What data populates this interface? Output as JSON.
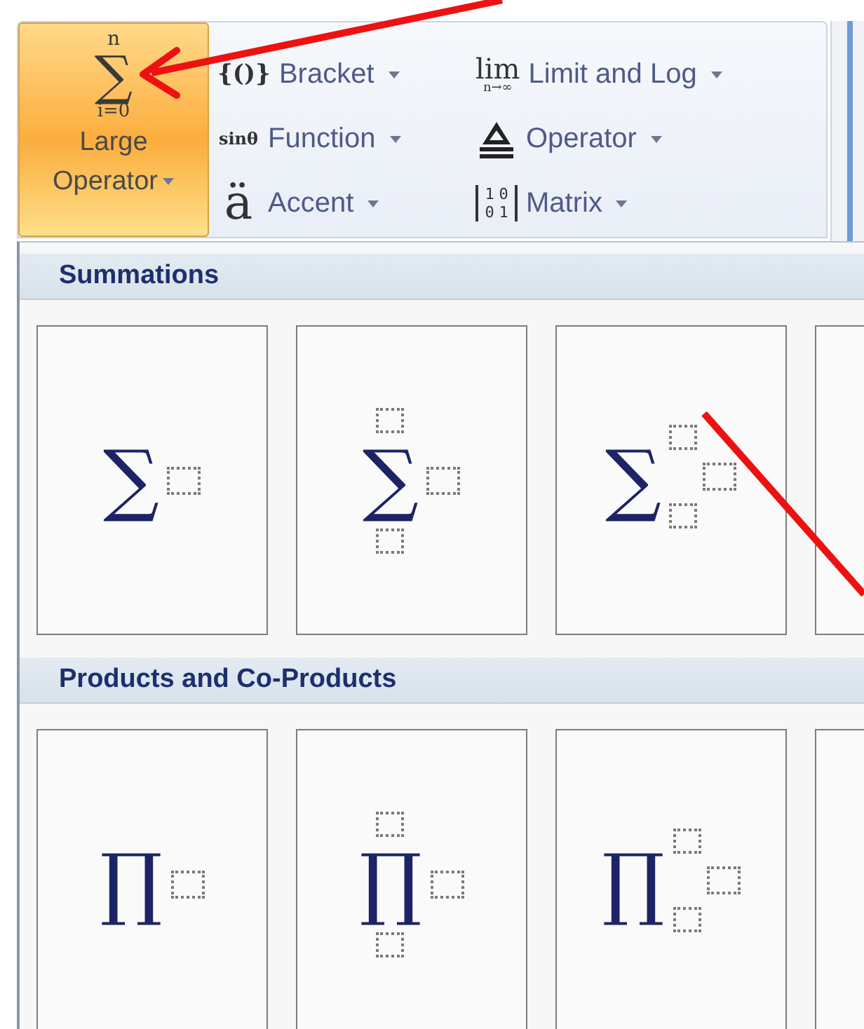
{
  "ribbon": {
    "large_operator": {
      "label": "Large Operator",
      "highlighted": true,
      "icon": {
        "top": "n",
        "symbol": "∑",
        "bottom": "i=0"
      }
    },
    "commands": [
      {
        "label": "Bracket",
        "icon": {
          "kind": "glyph",
          "text": "{()}"
        }
      },
      {
        "label": "Limit and Log",
        "icon": {
          "kind": "limit",
          "top": "lim",
          "bottom": "n→∞"
        }
      },
      {
        "label": "Function",
        "icon": {
          "kind": "small",
          "text": "sinθ"
        }
      },
      {
        "label": "Operator",
        "icon": {
          "kind": "delta"
        }
      },
      {
        "label": "Accent",
        "icon": {
          "kind": "accent",
          "text": "ä"
        }
      },
      {
        "label": "Matrix",
        "icon": {
          "kind": "matrix",
          "cells": [
            "1",
            "0",
            "0",
            "1"
          ]
        }
      }
    ]
  },
  "gallery": {
    "sections": [
      {
        "title": "Summations",
        "tiles": [
          {
            "kind": "plain",
            "symbol": "∑"
          },
          {
            "kind": "over-under",
            "symbol": "∑"
          },
          {
            "kind": "sub-sup",
            "symbol": "∑"
          },
          {
            "kind": "empty"
          }
        ]
      },
      {
        "title": "Products and Co-Products",
        "tiles": [
          {
            "kind": "plain",
            "symbol": "∏"
          },
          {
            "kind": "over-under",
            "symbol": "∏"
          },
          {
            "kind": "sub-sup",
            "symbol": "∏"
          },
          {
            "kind": "empty"
          }
        ]
      }
    ]
  }
}
